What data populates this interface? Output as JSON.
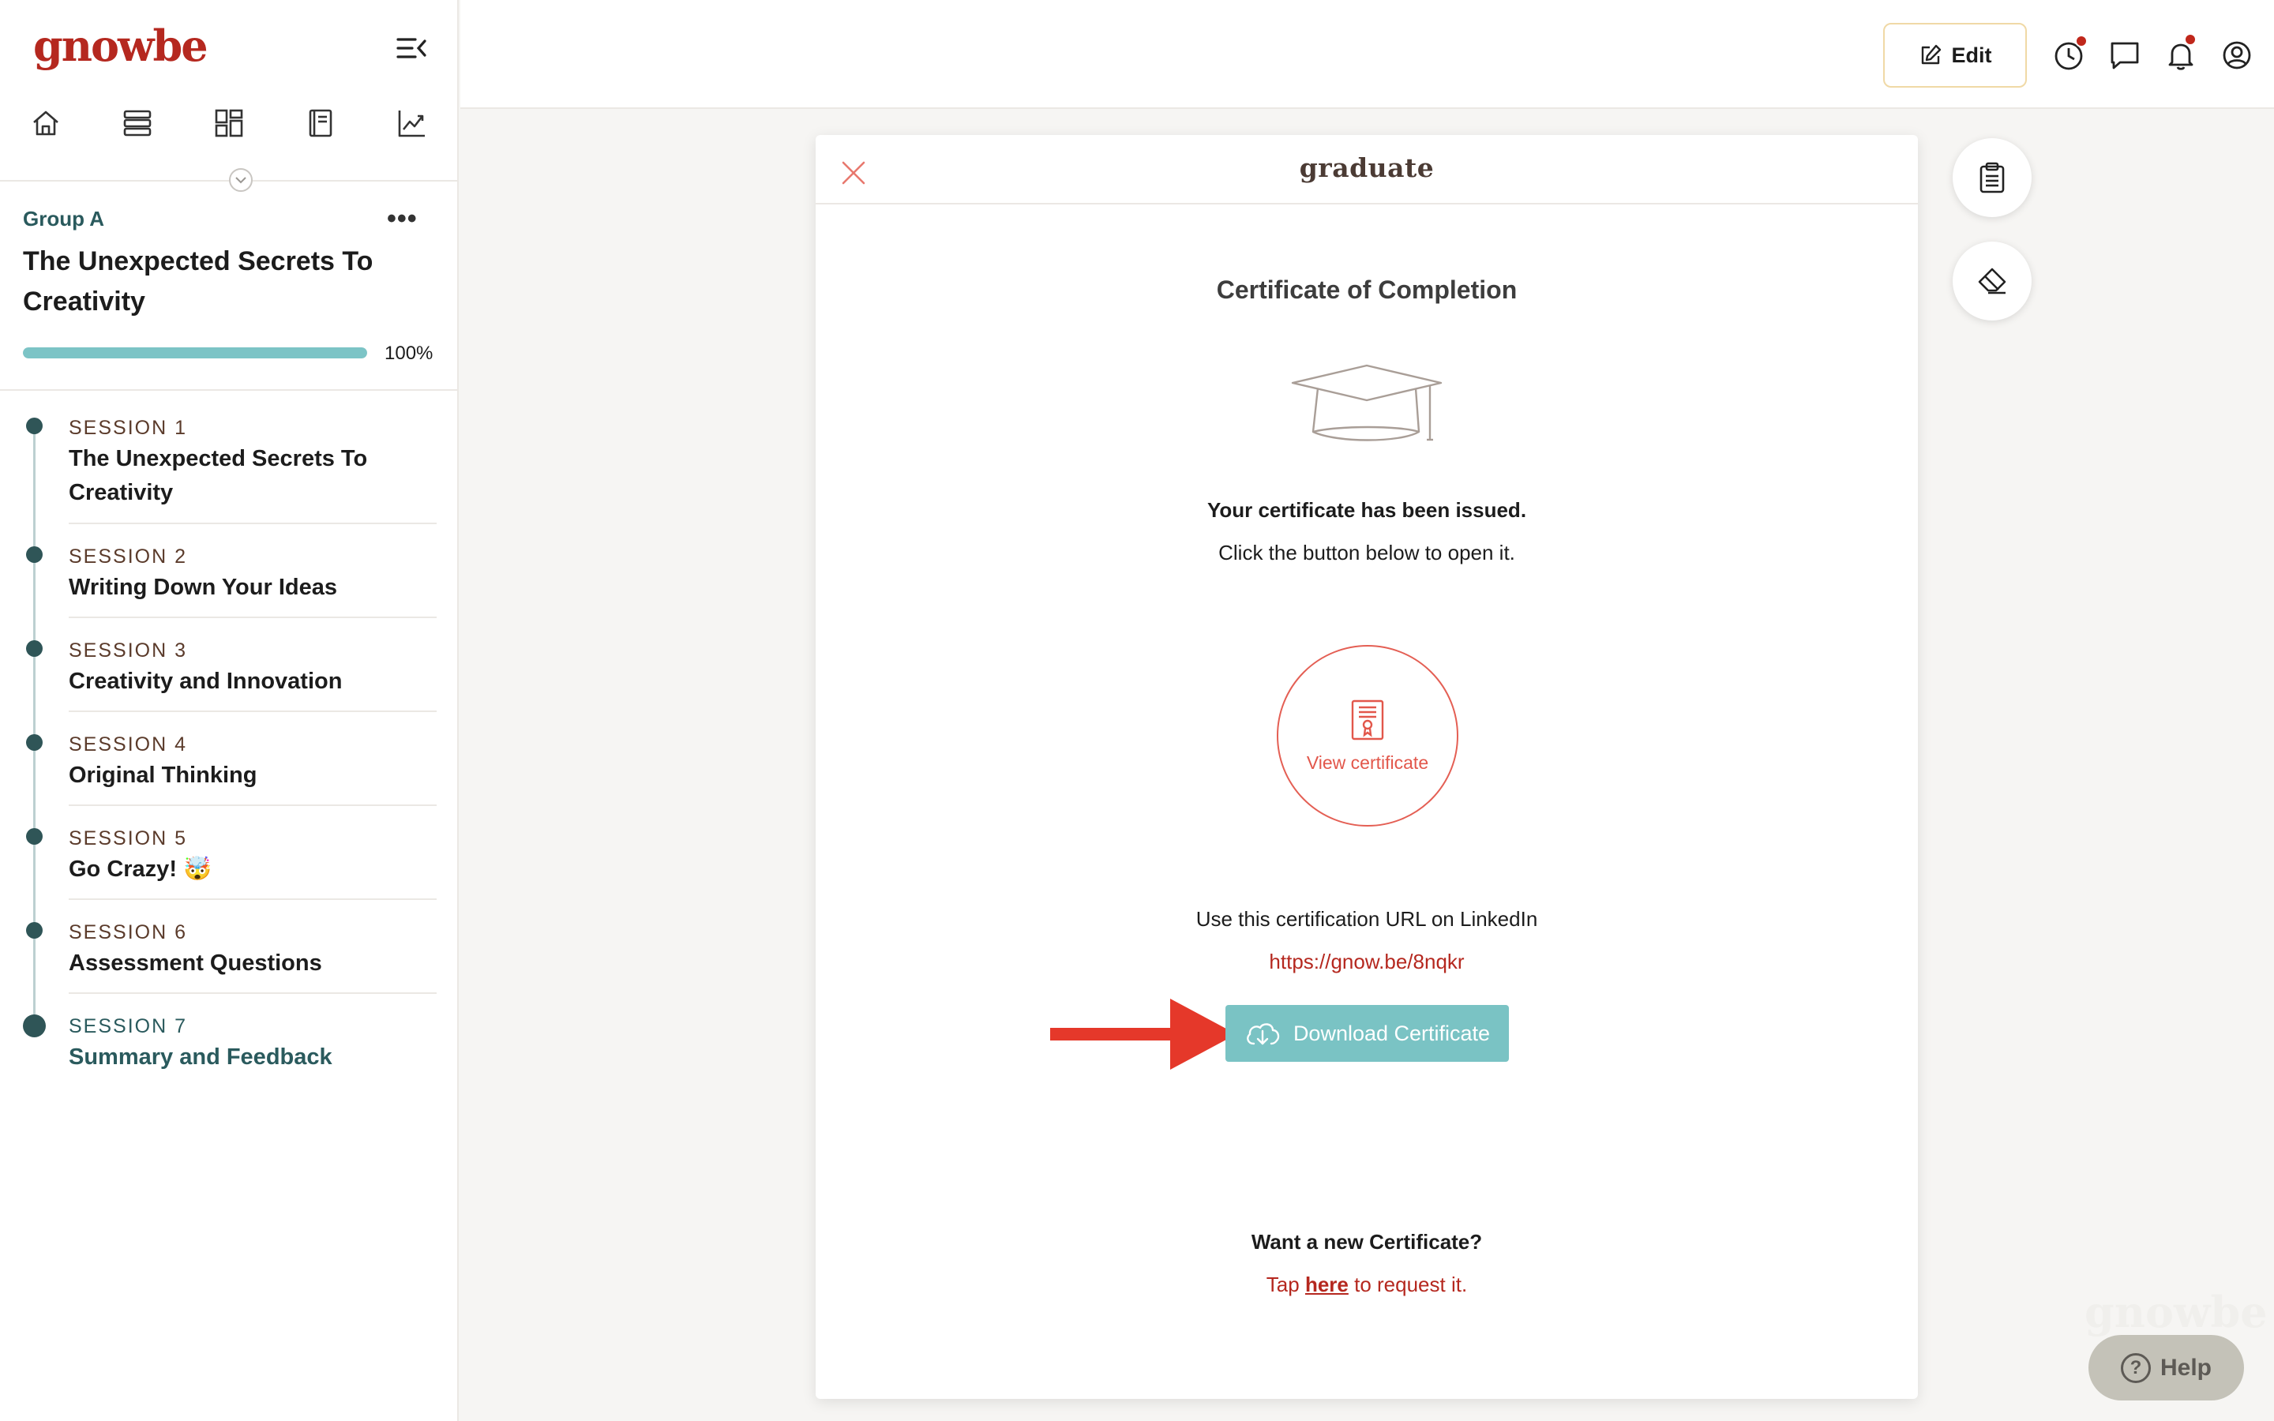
{
  "sidebar": {
    "logo": "gnowbe",
    "nav_icons": [
      "home-icon",
      "sessions-list-icon",
      "dashboard-icon",
      "journal-icon",
      "analytics-icon"
    ],
    "group_label": "Group A",
    "more_label": "•••",
    "course_title": "The Unexpected Secrets To Creativity",
    "progress_percent": 100,
    "progress_label": "100%",
    "sessions": [
      {
        "number": "SESSION 1",
        "title": "The Unexpected Secrets To Creativity",
        "active": false
      },
      {
        "number": "SESSION 2",
        "title": "Writing Down Your Ideas",
        "active": false
      },
      {
        "number": "SESSION 3",
        "title": "Creativity and Innovation",
        "active": false
      },
      {
        "number": "SESSION 4",
        "title": "Original Thinking",
        "active": false
      },
      {
        "number": "SESSION 5",
        "title": "Go Crazy! 🤯",
        "active": false
      },
      {
        "number": "SESSION 6",
        "title": "Assessment Questions",
        "active": false
      },
      {
        "number": "SESSION 7",
        "title": "Summary and Feedback",
        "active": true
      }
    ]
  },
  "topbar": {
    "edit_label": "Edit",
    "icons": [
      "history-icon",
      "chat-icon",
      "bell-icon",
      "profile-icon"
    ]
  },
  "modal": {
    "header_title": "graduate",
    "heading": "Certificate of Completion",
    "issued_text": "Your certificate has been issued.",
    "instruction_text": "Click the button below to open it.",
    "view_certificate_label": "View certificate",
    "linkedin_text": "Use this certification URL on LinkedIn",
    "certificate_url": "https://gnow.be/8nqkr",
    "download_label": "Download Certificate",
    "new_cert_heading": "Want a new Certificate?",
    "tap_prefix": "Tap ",
    "tap_link": "here",
    "tap_suffix": " to request it."
  },
  "right_actions": [
    "clipboard-icon",
    "eraser-icon"
  ],
  "help_label": "Help",
  "colors": {
    "brand_red": "#b5281f",
    "teal": "#7ac3c4",
    "dark_teal": "#2a5a5d",
    "coral": "#e45f54"
  }
}
